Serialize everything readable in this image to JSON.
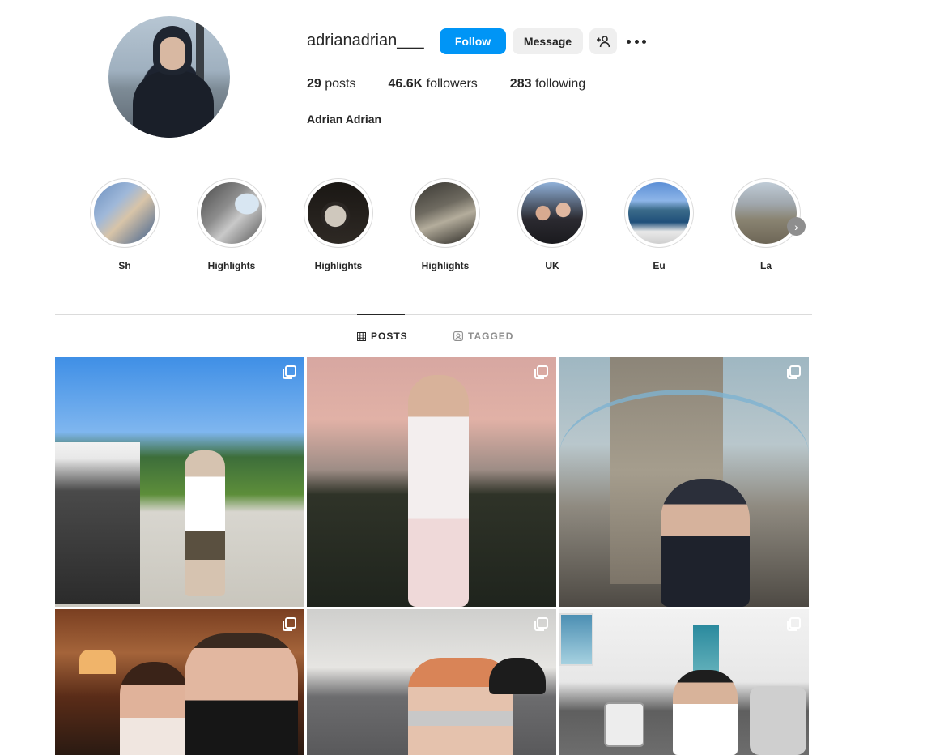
{
  "profile": {
    "username": "adrianadrian___",
    "full_name": "Adrian Adrian",
    "follow_label": "Follow",
    "message_label": "Message",
    "posts_count": "29",
    "posts_word": "posts",
    "followers_count": "46.6K",
    "followers_word": "followers",
    "following_count": "283",
    "following_word": "following"
  },
  "highlights": [
    {
      "label": "Sh"
    },
    {
      "label": "Highlights"
    },
    {
      "label": "Highlights"
    },
    {
      "label": "Highlights"
    },
    {
      "label": "UK"
    },
    {
      "label": "Eu"
    },
    {
      "label": "La"
    }
  ],
  "tabs": {
    "posts": "POSTS",
    "tagged": "TAGGED"
  },
  "icons": {
    "add_user": "add-user-icon",
    "more": "more-options-icon",
    "grid": "grid-icon",
    "tagged": "tagged-icon",
    "carousel": "carousel-icon",
    "next": "chevron-right-icon"
  },
  "colors": {
    "accent": "#0095f6",
    "secondary_button": "#efefef",
    "text": "#262626",
    "muted": "#8e8e8e"
  }
}
